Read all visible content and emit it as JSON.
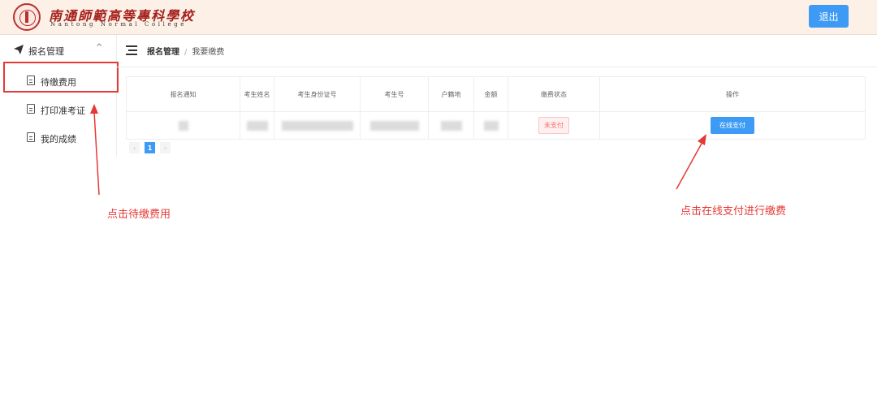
{
  "header": {
    "logo_cn": "南通師範高等專科學校",
    "logo_en": "Nantong Normal College",
    "logout_label": "退出"
  },
  "sidebar": {
    "group_label": "报名管理",
    "items": [
      {
        "label": "待缴费用",
        "icon": "document-icon"
      },
      {
        "label": "打印准考证",
        "icon": "document-icon"
      },
      {
        "label": "我的成绩",
        "icon": "document-icon"
      }
    ]
  },
  "breadcrumb": {
    "parent": "报名管理",
    "current": "我要缴费"
  },
  "table": {
    "headers": [
      "报名通知",
      "考生姓名",
      "考生身份证号",
      "考生号",
      "户籍地",
      "金额",
      "缴费状态",
      "操作"
    ],
    "rows": [
      {
        "status": "未支付",
        "action_label": "在线支付"
      }
    ]
  },
  "pagination": {
    "prev": "‹",
    "current_page": "1",
    "next": "›"
  },
  "annotations": {
    "left": "点击待缴费用",
    "right": "点击在线支付进行缴费"
  },
  "colors": {
    "accent": "#3d9bf5",
    "annotation": "#e53935",
    "header_bg": "#fdf1e7"
  }
}
